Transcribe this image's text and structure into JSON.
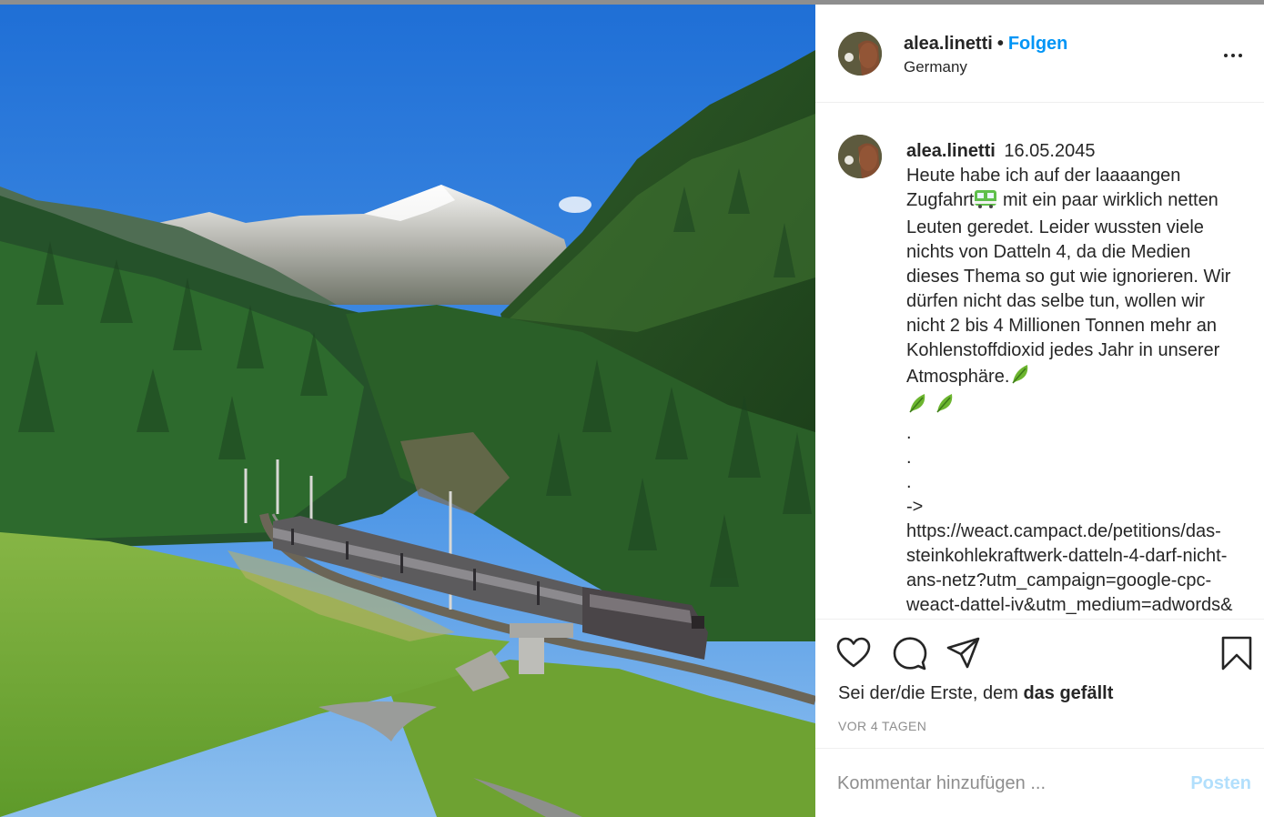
{
  "colors": {
    "accent": "#0095f6",
    "post_disabled": "#b2dffc",
    "muted": "#8e8e8e",
    "text": "#262626"
  },
  "photo": {
    "alt": ""
  },
  "header": {
    "username": "alea.linetti",
    "separator": "•",
    "follow_label": "Folgen",
    "location": "Germany",
    "more_icon": "more-horizontal-icon"
  },
  "caption": {
    "username": "alea.linetti",
    "date": "16.05.2045",
    "text_1": "Heute habe ich auf der laaaangen Zugfahrt",
    "emoji_train": "train-emoji",
    "text_2": " mit ein paar wirklich netten Leuten geredet. Leider wussten viele nichts von Datteln 4, da die Medien dieses Thema so gut wie ignorieren. Wir dürfen nicht das selbe tun, wollen wir nicht 2 bis 4 Millionen Tonnen mehr an Kohlenstoffdioxid jedes Jahr in unserer Atmosphäre.",
    "emoji_leaf": "leaf-emoji",
    "dots": ".\n.\n.",
    "link": "-> https://weact.campact.de/petitions/das-steinkohlekraftwerk-datteln-4-darf-nicht-ans-netz?utm_campaign=google-cpc-weact-dattel-iv&utm_medium=adwords&"
  },
  "actions": {
    "like_icon": "heart-icon",
    "comment_icon": "comment-icon",
    "share_icon": "paper-plane-icon",
    "save_icon": "bookmark-icon",
    "likes_prefix": "Sei der/die Erste, dem ",
    "likes_bold": "das gefällt",
    "time_ago": "VOR 4 TAGEN"
  },
  "comment_box": {
    "placeholder": "Kommentar hinzufügen ...",
    "post_label": "Posten"
  }
}
